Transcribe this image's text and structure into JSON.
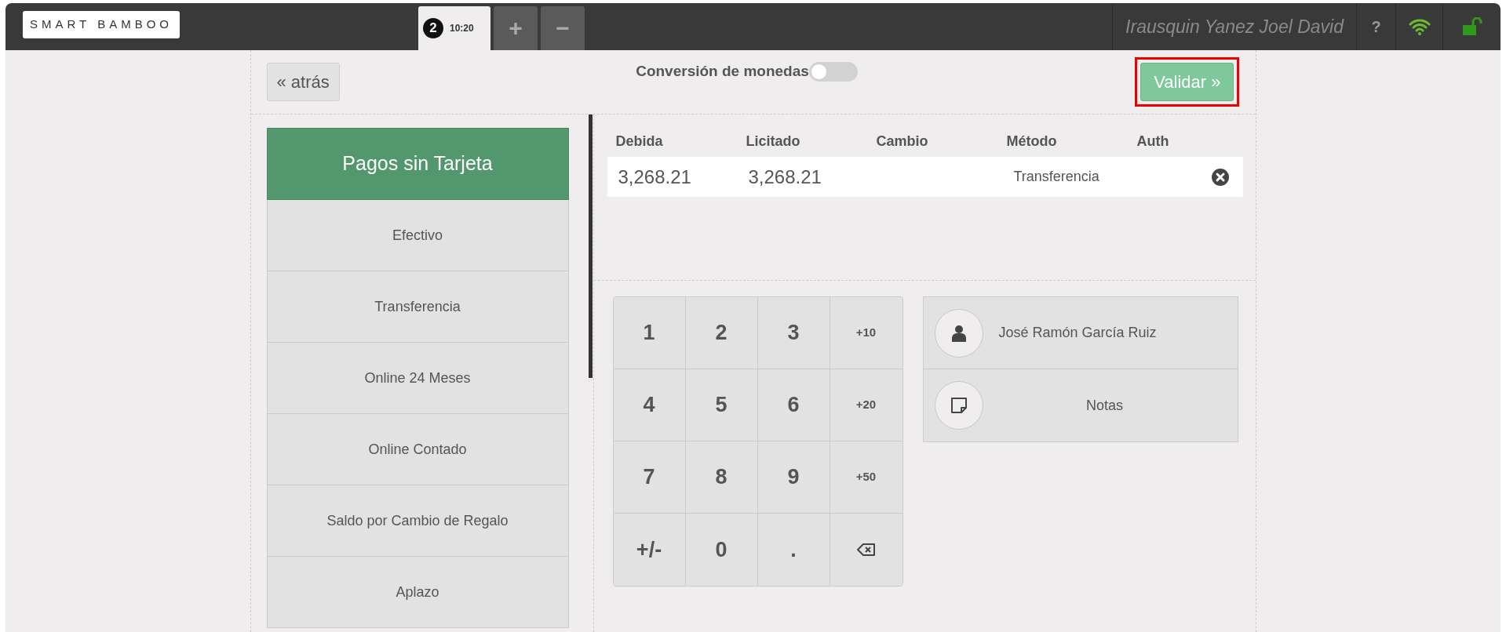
{
  "topbar": {
    "logo": "SMART BAMBOO",
    "tabs": [
      {
        "number": "2",
        "time": "10:20",
        "selected": true
      }
    ],
    "tab_actions": [
      "+",
      "−"
    ],
    "user": "Irausquin Yanez Joel David",
    "help": "?"
  },
  "toolbar": {
    "back": "« atrás",
    "conversion": {
      "label": "Conversión de monedas",
      "on": false
    },
    "validate": {
      "label": "Validar »",
      "highlighted": true
    }
  },
  "payment_panel": {
    "title": "Pagos sin Tarjeta",
    "methods": [
      "Efectivo",
      "Transferencia",
      "Online 24 Meses",
      "Online Contado",
      "Saldo por Cambio de Regalo",
      "Aplazo"
    ]
  },
  "payments_table": {
    "columns": [
      "Debida",
      "Licitado",
      "Cambio",
      "Método",
      "Auth"
    ],
    "rows": [
      {
        "due": "3,268.21",
        "tendered": "3,268.21",
        "method": "Transferencia",
        "removable": true
      }
    ]
  },
  "keypad": [
    {
      "kind": "digit",
      "label": "1"
    },
    {
      "kind": "digit",
      "label": "2"
    },
    {
      "kind": "digit",
      "label": "3"
    },
    {
      "kind": "small",
      "label": "+10"
    },
    {
      "kind": "digit",
      "label": "4"
    },
    {
      "kind": "digit",
      "label": "5"
    },
    {
      "kind": "digit",
      "label": "6"
    },
    {
      "kind": "small",
      "label": "+20"
    },
    {
      "kind": "digit",
      "label": "7"
    },
    {
      "kind": "digit",
      "label": "8"
    },
    {
      "kind": "digit",
      "label": "9"
    },
    {
      "kind": "small",
      "label": "+50"
    },
    {
      "kind": "digit",
      "label": "+/-"
    },
    {
      "kind": "digit",
      "label": "0"
    },
    {
      "kind": "digit",
      "label": "."
    },
    {
      "kind": "backspace"
    }
  ],
  "actions": [
    {
      "kind": "customer",
      "label": "José Ramón García Ruiz"
    },
    {
      "kind": "notes",
      "label": "Notas"
    }
  ]
}
